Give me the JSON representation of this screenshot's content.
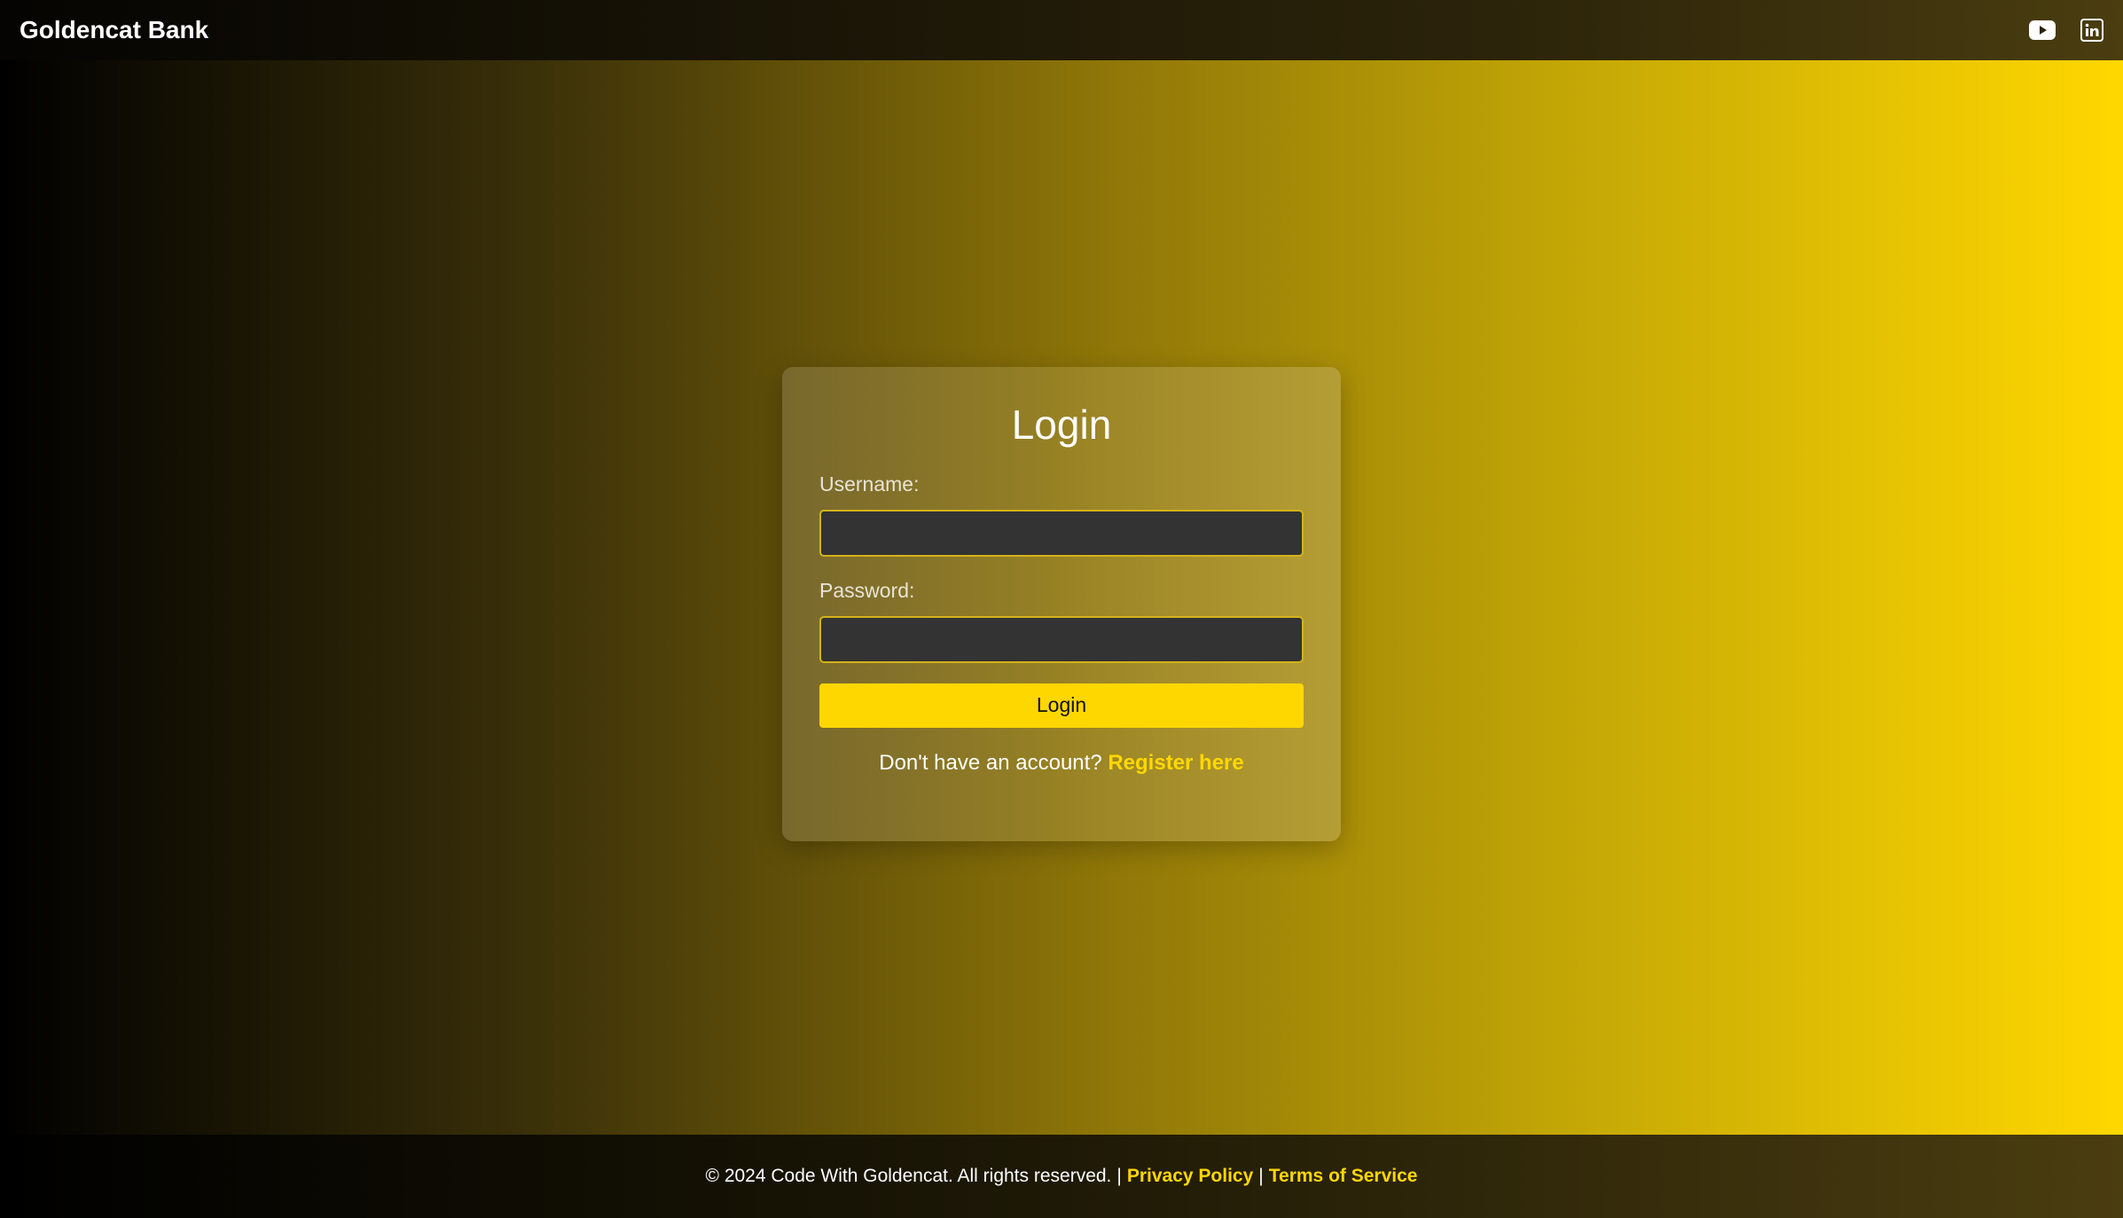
{
  "header": {
    "brand": "Goldencat Bank",
    "social_icons": [
      "youtube-icon",
      "linkedin-icon"
    ]
  },
  "login_form": {
    "title": "Login",
    "username_label": "Username:",
    "username_value": "",
    "password_label": "Password:",
    "password_value": "",
    "submit_label": "Login",
    "register_prompt": "Don't have an account?",
    "register_link": "Register here"
  },
  "footer": {
    "copyright": "© 2024 Code With Goldencat. All rights reserved.",
    "separator": "|",
    "privacy_link": "Privacy Policy",
    "terms_link": "Terms of Service"
  },
  "colors": {
    "accent": "#ffd700",
    "input_bg": "#333333",
    "input_border": "#d4b21a"
  }
}
